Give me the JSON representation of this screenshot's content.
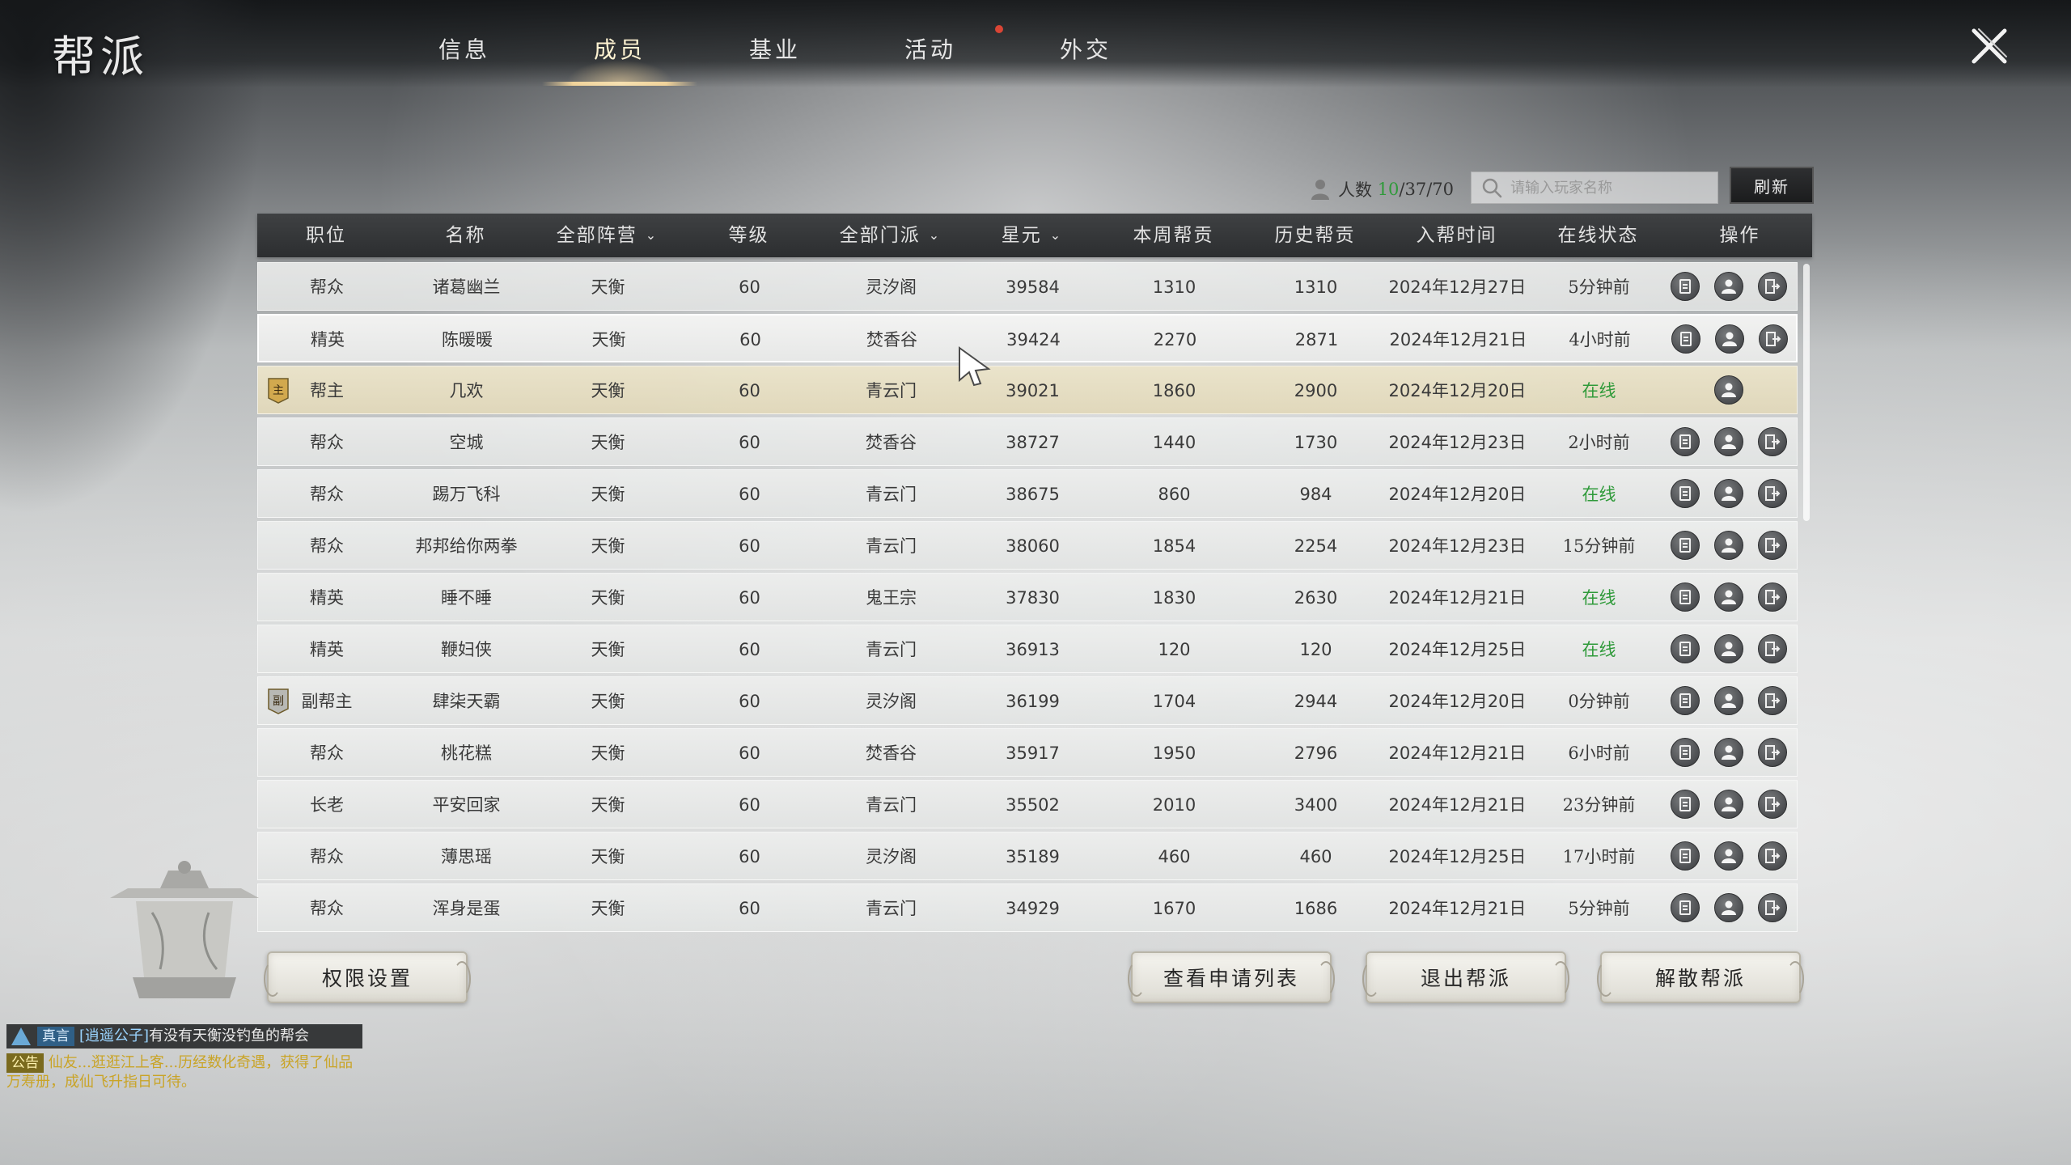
{
  "title": "帮派",
  "tabs": [
    {
      "label": "信息",
      "active": false
    },
    {
      "label": "成员",
      "active": true
    },
    {
      "label": "基业",
      "active": false
    },
    {
      "label": "活动",
      "active": false,
      "notify": true
    },
    {
      "label": "外交",
      "active": false
    }
  ],
  "member_count": {
    "label": "人数",
    "online": "10",
    "rest": "/37/70"
  },
  "search": {
    "placeholder": "请输入玩家名称"
  },
  "refresh_label": "刷新",
  "columns": [
    "职位",
    "名称",
    "全部阵营",
    "等级",
    "全部门派",
    "星元",
    "本周帮贡",
    "历史帮贡",
    "入帮时间",
    "在线状态",
    "操作"
  ],
  "members": [
    {
      "rank": "帮众",
      "name": "诸葛幽兰",
      "camp": "天衡",
      "level": "60",
      "sect": "灵汐阁",
      "star": "39584",
      "week": "1310",
      "total": "1310",
      "join": "2024年12月27日",
      "status": "5分钟前"
    },
    {
      "rank": "精英",
      "name": "陈暖暖",
      "camp": "天衡",
      "level": "60",
      "sect": "焚香谷",
      "star": "39424",
      "week": "2270",
      "total": "2871",
      "join": "2024年12月21日",
      "status": "4小时前"
    },
    {
      "rank": "帮主",
      "name": "几欢",
      "camp": "天衡",
      "level": "60",
      "sect": "青云门",
      "star": "39021",
      "week": "1860",
      "total": "2900",
      "join": "2024年12月20日",
      "status": "在线"
    },
    {
      "rank": "帮众",
      "name": "空城",
      "camp": "天衡",
      "level": "60",
      "sect": "焚香谷",
      "star": "38727",
      "week": "1440",
      "total": "1730",
      "join": "2024年12月23日",
      "status": "2小时前"
    },
    {
      "rank": "帮众",
      "name": "踢万飞科",
      "camp": "天衡",
      "level": "60",
      "sect": "青云门",
      "star": "38675",
      "week": "860",
      "total": "984",
      "join": "2024年12月20日",
      "status": "在线"
    },
    {
      "rank": "帮众",
      "name": "邦邦给你两拳",
      "camp": "天衡",
      "level": "60",
      "sect": "青云门",
      "star": "38060",
      "week": "1854",
      "total": "2254",
      "join": "2024年12月23日",
      "status": "15分钟前"
    },
    {
      "rank": "精英",
      "name": "睡不睡",
      "camp": "天衡",
      "level": "60",
      "sect": "鬼王宗",
      "star": "37830",
      "week": "1830",
      "total": "2630",
      "join": "2024年12月21日",
      "status": "在线"
    },
    {
      "rank": "精英",
      "name": "鞭妇侠",
      "camp": "天衡",
      "level": "60",
      "sect": "青云门",
      "star": "36913",
      "week": "120",
      "total": "120",
      "join": "2024年12月25日",
      "status": "在线"
    },
    {
      "rank": "副帮主",
      "name": "肆柒天霸",
      "camp": "天衡",
      "level": "60",
      "sect": "灵汐阁",
      "star": "36199",
      "week": "1704",
      "total": "2944",
      "join": "2024年12月20日",
      "status": "0分钟前"
    },
    {
      "rank": "帮众",
      "name": "桃花糕",
      "camp": "天衡",
      "level": "60",
      "sect": "焚香谷",
      "star": "35917",
      "week": "1950",
      "total": "2796",
      "join": "2024年12月21日",
      "status": "6小时前"
    },
    {
      "rank": "长老",
      "name": "平安回家",
      "camp": "天衡",
      "level": "60",
      "sect": "青云门",
      "star": "35502",
      "week": "2010",
      "total": "3400",
      "join": "2024年12月21日",
      "status": "23分钟前"
    },
    {
      "rank": "帮众",
      "name": "薄思瑶",
      "camp": "天衡",
      "level": "60",
      "sect": "灵汐阁",
      "star": "35189",
      "week": "460",
      "total": "460",
      "join": "2024年12月25日",
      "status": "17小时前"
    },
    {
      "rank": "帮众",
      "name": "浑身是蛋",
      "camp": "天衡",
      "level": "60",
      "sect": "青云门",
      "star": "34929",
      "week": "1670",
      "total": "1686",
      "join": "2024年12月21日",
      "status": "5分钟前"
    }
  ],
  "rank_badges": {
    "leader": "主",
    "vice": "副"
  },
  "buttons": {
    "permissions": "权限设置",
    "applications": "查看申请列表",
    "leave": "退出帮派",
    "disband": "解散帮派"
  },
  "chat": {
    "channel": "真言",
    "speaker": "[逍遥公子]",
    "message": "有没有天衡没钓鱼的帮会",
    "notice_tag": "公告",
    "notice_text": "仙友...逛逛江上客...历经数化奇遇，获得了仙品万寿册，成仙飞升指日可待。"
  },
  "colors": {
    "online": "#2f9a3a",
    "accent_gold": "#f1d39a",
    "notify_dot": "#d94535"
  }
}
